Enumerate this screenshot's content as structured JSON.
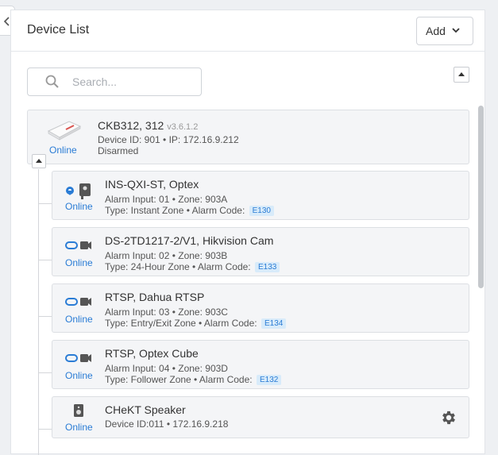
{
  "header": {
    "title": "Device List",
    "add_label": "Add"
  },
  "search": {
    "placeholder": "Search..."
  },
  "controller": {
    "name": "CKB312, 312",
    "version": "v3.6.1.2",
    "id_ip": "Device ID: 901 • IP: 172.16.9.212",
    "state": "Disarmed",
    "status": "Online"
  },
  "zones": [
    {
      "name": "INS-QXI-ST, Optex",
      "line1": "Alarm Input: 01 • Zone: 903A",
      "line2": "Type: Instant Zone • Alarm Code:",
      "code": "E130",
      "status": "Online",
      "icon": "motion-sensor-icon"
    },
    {
      "name": "DS-2TD1217-2/V1, Hikvision Cam",
      "line1": "Alarm Input: 02 • Zone: 903B",
      "line2": "Type: 24-Hour Zone • Alarm Code:",
      "code": "E133",
      "status": "Online",
      "icon": "camera-icon"
    },
    {
      "name": "RTSP, Dahua RTSP",
      "line1": "Alarm Input: 03 • Zone: 903C",
      "line2": "Type: Entry/Exit Zone • Alarm Code:",
      "code": "E134",
      "status": "Online",
      "icon": "camera-icon"
    },
    {
      "name": "RTSP, Optex Cube",
      "line1": "Alarm Input: 04 • Zone: 903D",
      "line2": "Type: Follower Zone • Alarm Code:",
      "code": "E132",
      "status": "Online",
      "icon": "camera-icon"
    }
  ],
  "speaker": {
    "name": "CHeKT Speaker",
    "info": "Device ID:011 • 172.16.9.218",
    "status": "Online"
  },
  "colors": {
    "link_blue": "#2a7cd5",
    "green": "#3da24c",
    "badge_bg": "#d8ebfa"
  }
}
